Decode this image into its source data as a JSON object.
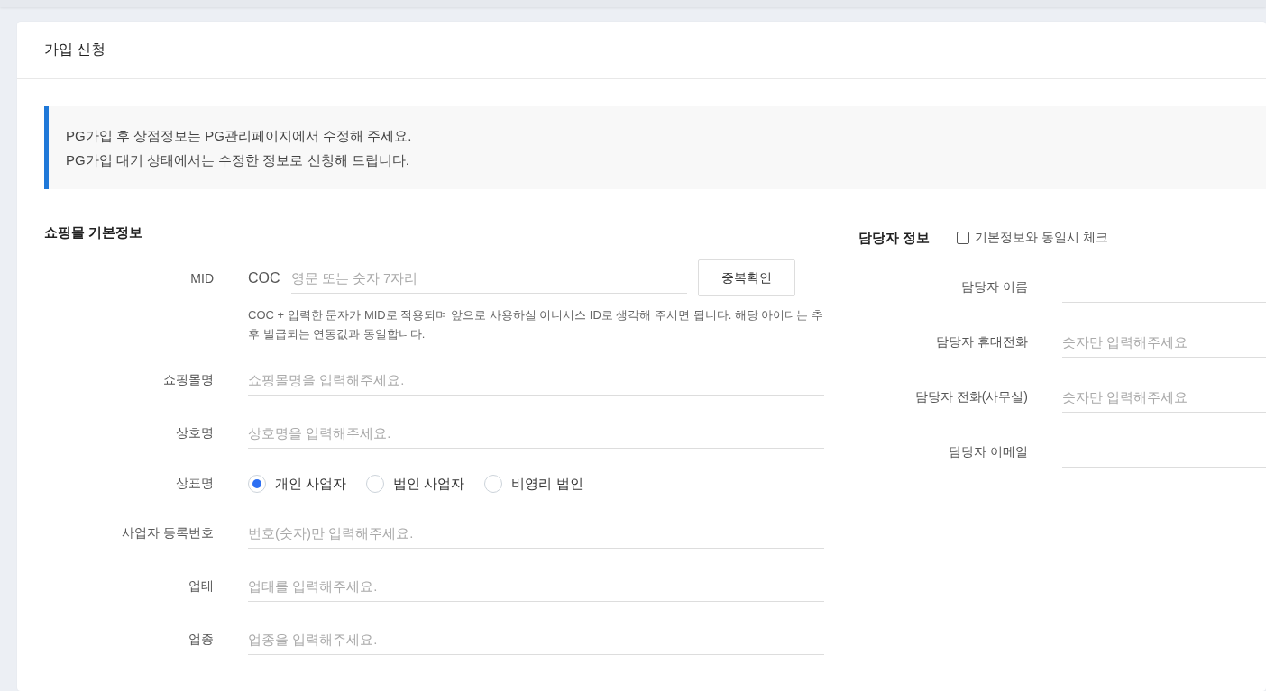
{
  "card": {
    "title": "가입 신청"
  },
  "notice": {
    "lines": [
      "PG가입 후 상점정보는 PG관리페이지에서 수정해 주세요.",
      "PG가입 대기 상태에서는 수정한 정보로 신청해 드립니다."
    ]
  },
  "basic_info": {
    "title": "쇼핑몰 기본정보",
    "fields": [
      {
        "kind": "mid",
        "label": "MID",
        "prefix": "COC",
        "placeholder": "영문 또는 숫자 7자리",
        "button": "중복확인",
        "help": "COC + 입력한 문자가 MID로 적용되며 앞으로 사용하실 이니시스 ID로 생각해 주시면 됩니다. 해당 아이디는 추후 발급되는 연동값과 동일합니다."
      },
      {
        "kind": "text",
        "label": "쇼핑몰명",
        "placeholder": "쇼핑몰명을 입력해주세요."
      },
      {
        "kind": "text",
        "label": "상호명",
        "placeholder": "상호명을 입력해주세요."
      },
      {
        "kind": "radio",
        "label": "상표명",
        "options": [
          {
            "label": "개인 사업자",
            "selected": true
          },
          {
            "label": "법인 사업자",
            "selected": false
          },
          {
            "label": "비영리 법인",
            "selected": false
          }
        ]
      },
      {
        "kind": "text",
        "label": "사업자 등록번호",
        "placeholder": "번호(숫자)만 입력해주세요."
      },
      {
        "kind": "text",
        "label": "업태",
        "placeholder": "업태를 입력해주세요."
      },
      {
        "kind": "text",
        "label": "업종",
        "placeholder": "업종을 입력해주세요."
      }
    ]
  },
  "contact_info": {
    "title": "담당자 정보",
    "same_as_basic": {
      "label": "기본정보와 동일시 체크",
      "checked": false
    },
    "fields": [
      {
        "kind": "text",
        "label": "담당자 이름"
      },
      {
        "kind": "text",
        "label": "담당자 휴대전화",
        "placeholder": "숫자만 입력해주세요"
      },
      {
        "kind": "text",
        "label": "담당자 전화(사무실)",
        "placeholder": "숫자만 입력해주세요"
      },
      {
        "kind": "text",
        "label": "담당자 이메일"
      }
    ]
  }
}
